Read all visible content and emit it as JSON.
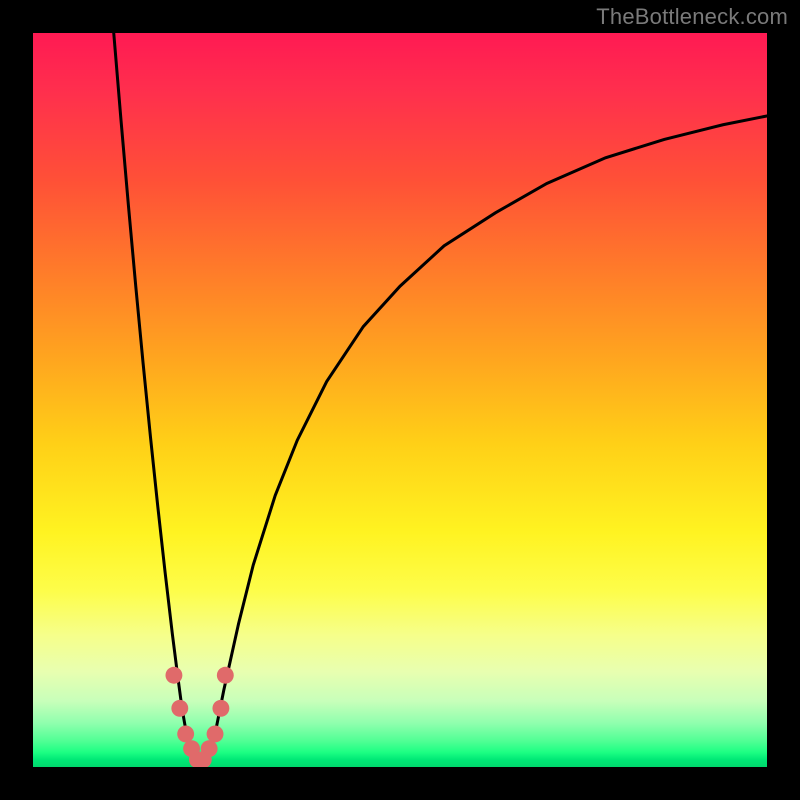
{
  "watermark": "TheBottleneck.com",
  "chart_data": {
    "type": "line",
    "title": "",
    "xlabel": "",
    "ylabel": "",
    "xlim": [
      0,
      100
    ],
    "ylim": [
      0,
      100
    ],
    "grid": false,
    "legend": false,
    "series": [
      {
        "name": "curve-left",
        "x": [
          11.0,
          12.0,
          13.0,
          14.0,
          15.0,
          16.0,
          17.0,
          18.0,
          19.0,
          19.7,
          20.3,
          21.0,
          21.7
        ],
        "y": [
          100.0,
          88.0,
          76.5,
          65.5,
          55.0,
          45.0,
          35.5,
          26.5,
          18.0,
          12.5,
          8.0,
          4.0,
          1.5
        ]
      },
      {
        "name": "curve-right",
        "x": [
          24.0,
          25.0,
          26.0,
          28.0,
          30.0,
          33.0,
          36.0,
          40.0,
          45.0,
          50.0,
          56.0,
          63.0,
          70.0,
          78.0,
          86.0,
          94.0,
          100.0
        ],
        "y": [
          1.5,
          5.5,
          10.5,
          19.5,
          27.5,
          37.0,
          44.5,
          52.5,
          60.0,
          65.5,
          71.0,
          75.5,
          79.5,
          83.0,
          85.5,
          87.5,
          88.7
        ]
      },
      {
        "name": "valley-dots",
        "x": [
          19.2,
          20.0,
          20.8,
          21.6,
          22.4,
          23.2,
          24.0,
          24.8,
          25.6,
          26.2
        ],
        "y": [
          12.5,
          8.0,
          4.5,
          2.5,
          1.0,
          1.0,
          2.5,
          4.5,
          8.0,
          12.5
        ]
      }
    ],
    "gradient_stops": [
      {
        "pos": 0,
        "color": "#ff1a53"
      },
      {
        "pos": 20,
        "color": "#ff5037"
      },
      {
        "pos": 44,
        "color": "#ffa41f"
      },
      {
        "pos": 68,
        "color": "#fff321"
      },
      {
        "pos": 91,
        "color": "#c8ffba"
      },
      {
        "pos": 100,
        "color": "#00d86d"
      }
    ],
    "dot_color": "#e06a6a",
    "curve_color": "#000000"
  }
}
